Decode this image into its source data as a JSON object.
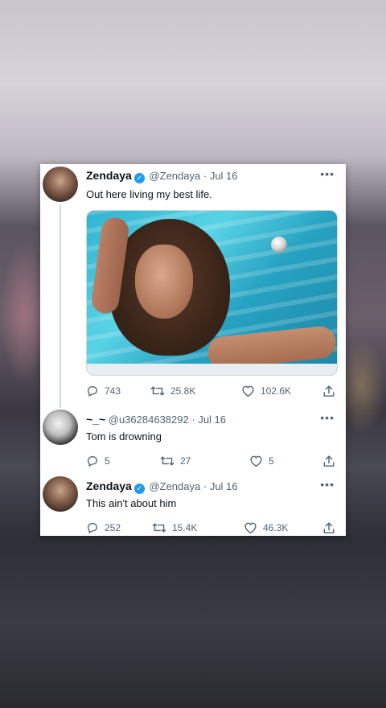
{
  "tweets": [
    {
      "name": "Zendaya",
      "handle": "@Zendaya",
      "date": "Jul 16",
      "verified": true,
      "text": "Out here living my best life.",
      "replies": "743",
      "retweets": "25.8K",
      "likes": "102.6K",
      "has_media": true
    },
    {
      "name": "~_~",
      "handle": "@u36284638292",
      "date": "Jul 16",
      "verified": false,
      "text": "Tom is drowning",
      "replies": "5",
      "retweets": "27",
      "likes": "5"
    },
    {
      "name": "Zendaya",
      "handle": "@Zendaya",
      "date": "Jul 16",
      "verified": true,
      "text": "This ain't about him",
      "replies": "252",
      "retweets": "15.4K",
      "likes": "46.3K"
    }
  ],
  "separator": "·",
  "more_glyph": "•••",
  "verified_glyph": "✓",
  "colors": {
    "verified": "#1d9bf0",
    "secondary_text": "#536471",
    "primary_text": "#0f1419"
  },
  "icons": [
    "reply-icon",
    "retweet-icon",
    "like-icon",
    "share-icon",
    "verified-badge-icon",
    "more-icon"
  ]
}
